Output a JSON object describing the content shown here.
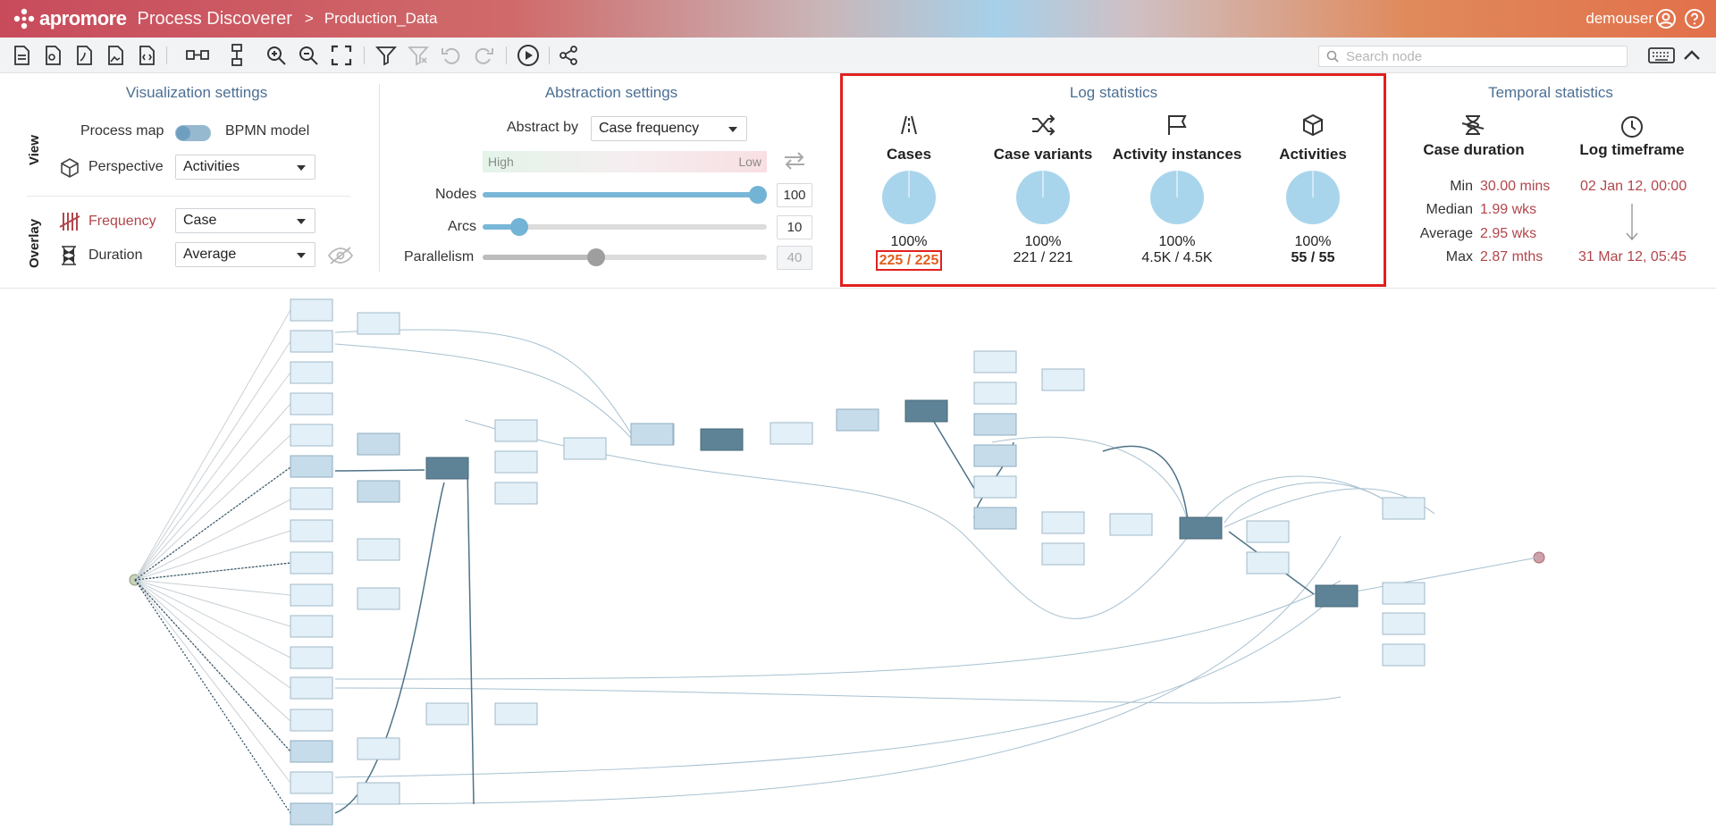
{
  "header": {
    "logo_text": "apromore",
    "app_name": "Process Discoverer",
    "crumb_sep": ">",
    "file_name": "Production_Data",
    "user": "demouser"
  },
  "search": {
    "placeholder": "Search node"
  },
  "visualization": {
    "title": "Visualization settings",
    "view_label": "View",
    "process_map": "Process map",
    "bpmn_model": "BPMN model",
    "perspective_label": "Perspective",
    "perspective_value": "Activities",
    "overlay_label": "Overlay",
    "frequency_label": "Frequency",
    "frequency_value": "Case",
    "duration_label": "Duration",
    "duration_value": "Average"
  },
  "abstraction": {
    "title": "Abstraction settings",
    "abstract_by_label": "Abstract by",
    "abstract_by_value": "Case frequency",
    "high": "High",
    "low": "Low",
    "nodes_label": "Nodes",
    "nodes_value": "100",
    "nodes_fraction": 1.0,
    "arcs_label": "Arcs",
    "arcs_value": "10",
    "arcs_fraction": 0.13,
    "parallelism_label": "Parallelism",
    "parallelism_value": "40",
    "parallelism_fraction": 0.4
  },
  "log_stats": {
    "title": "Log statistics",
    "items": [
      {
        "label": "Cases",
        "pct": "100%",
        "ratio": "225 / 225"
      },
      {
        "label": "Case variants",
        "pct": "100%",
        "ratio": "221 / 221"
      },
      {
        "label": "Activity instances",
        "pct": "100%",
        "ratio": "4.5K / 4.5K"
      },
      {
        "label": "Activities",
        "pct": "100%",
        "ratio": "55 / 55"
      }
    ]
  },
  "temporal": {
    "title": "Temporal statistics",
    "case_duration": "Case duration",
    "log_timeframe": "Log timeframe",
    "min_label": "Min",
    "min_value": "30.00 mins",
    "median_label": "Median",
    "median_value": "1.99 wks",
    "average_label": "Average",
    "average_value": "2.95 wks",
    "max_label": "Max",
    "max_value": "2.87 mths",
    "start": "02 Jan 12, 00:00",
    "end": "31 Mar 12, 05:45"
  },
  "colors": {
    "accent_red": "#b1464b",
    "pie": "#a9d5ec",
    "node_dark": "#5f8396",
    "node_light": "#e3f0f8"
  }
}
